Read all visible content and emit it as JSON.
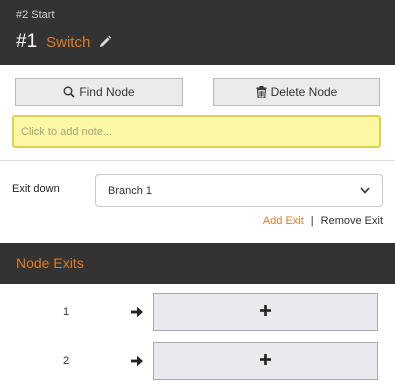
{
  "header": {
    "breadcrumb": "#2 Start",
    "node_number": "#1",
    "node_name": "Switch",
    "edit_icon": "pencil-icon"
  },
  "toolbar": {
    "find_node_label": "Find Node",
    "find_icon": "search-icon",
    "delete_node_label": "Delete Node",
    "delete_icon": "trash-icon"
  },
  "note": {
    "placeholder": "Click to add note..."
  },
  "exit_down": {
    "label": "Exit down",
    "selected": "Branch 1"
  },
  "exit_links": {
    "add": "Add Exit",
    "separator": "|",
    "remove": "Remove Exit"
  },
  "node_exits": {
    "title": "Node Exits",
    "rows": [
      {
        "number": "1",
        "arrow_icon": "arrow-right-icon",
        "action_icon": "plus-icon"
      },
      {
        "number": "2",
        "arrow_icon": "arrow-right-icon",
        "action_icon": "plus-icon"
      }
    ]
  },
  "colors": {
    "header_bg": "#333333",
    "accent": "#e07a26",
    "note_bg": "#fbf7a3",
    "note_border": "#ddd24a"
  }
}
